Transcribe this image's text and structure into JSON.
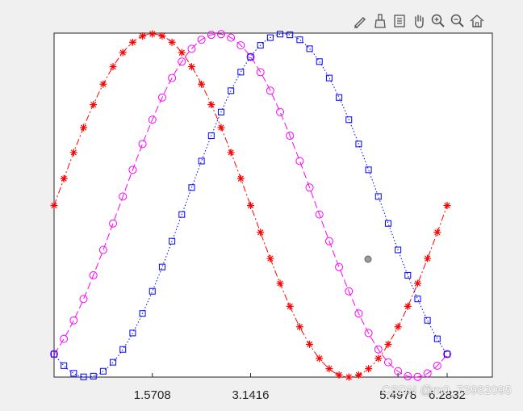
{
  "toolbar": {
    "buttons": [
      {
        "name": "edit-plot-icon"
      },
      {
        "name": "brush-icon"
      },
      {
        "name": "data-tips-icon"
      },
      {
        "name": "pan-icon"
      },
      {
        "name": "zoom-in-icon"
      },
      {
        "name": "zoom-out-icon"
      },
      {
        "name": "home-icon"
      }
    ]
  },
  "watermark": "CSDN @m0_73982095",
  "colors": {
    "figure_bg": "#f0f0f0",
    "axes_bg": "#ffffff",
    "series_red": "#ff0000",
    "series_magenta": "#ff00ff",
    "series_blue": "#0000ff"
  },
  "chart_data": {
    "type": "line",
    "title": "",
    "xlabel": "",
    "ylabel": "",
    "xlim": [
      0,
      6.2832
    ],
    "ylim": [
      -1,
      1
    ],
    "grid": false,
    "box": true,
    "xticks": [
      1.5708,
      3.1416,
      5.4978,
      6.2832
    ],
    "xtick_labels": [
      "1.5708",
      "3.1416",
      "5.4978",
      "6.2832"
    ],
    "yticks": [],
    "x_samples": {
      "start": 0,
      "end": 6.2832,
      "count": 41
    },
    "series": [
      {
        "function": "sin(x)",
        "color": "#ff0000",
        "line_style": "dash-dot",
        "marker": "asterisk"
      },
      {
        "function": "sin(x - pi/3)",
        "color": "#ff00ff",
        "line_style": "dashed",
        "marker": "circle"
      },
      {
        "function": "sin(x - 2*pi/3)",
        "color": "#0000ff",
        "line_style": "dotted",
        "marker": "square"
      }
    ]
  }
}
